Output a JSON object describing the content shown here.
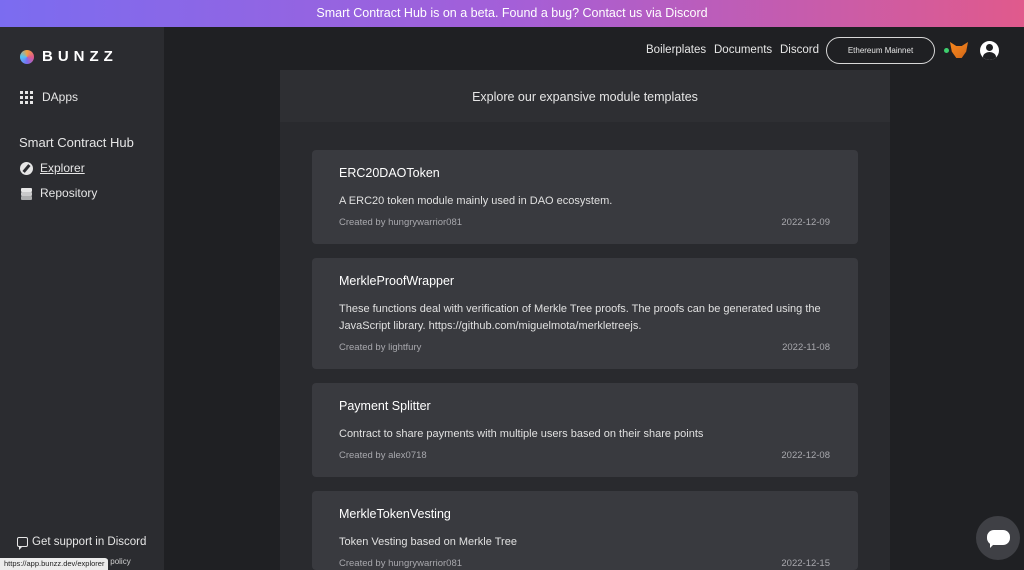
{
  "banner": {
    "text": "Smart Contract Hub is on a beta. Found a bug? Contact us via Discord"
  },
  "sidebar": {
    "logo_text": "BUNZZ",
    "dapps_label": "DApps",
    "hub_title": "Smart Contract Hub",
    "explorer_label": "Explorer",
    "repository_label": "Repository",
    "support_label": "Get support in Discord",
    "terms_label": "Terms of Service  Privacy policy"
  },
  "status_bar": {
    "url": "https://app.bunzz.dev/explorer"
  },
  "topnav": {
    "boilerplates": "Boilerplates",
    "documents": "Documents",
    "discord": "Discord",
    "network": "Ethereum Mainnet"
  },
  "main": {
    "header": "Explore our expansive module templates",
    "cards": [
      {
        "title": "ERC20DAOToken",
        "description": "A ERC20 token module mainly used in DAO ecosystem.",
        "author": "Created by hungrywarrior081",
        "date": "2022-12-09"
      },
      {
        "title": "MerkleProofWrapper",
        "description": "These functions deal with verification of Merkle Tree proofs. The proofs can be generated using the JavaScript library. https://github.com/miguelmota/merkletreejs.",
        "author": "Created by lightfury",
        "date": "2022-11-08"
      },
      {
        "title": "Payment Splitter",
        "description": "Contract to share payments with multiple users based on their share points",
        "author": "Created by alex0718",
        "date": "2022-12-08"
      },
      {
        "title": "MerkleTokenVesting",
        "description": "Token Vesting based on Merkle Tree",
        "author": "Created by hungrywarrior081",
        "date": "2022-12-15"
      }
    ]
  },
  "icons": {
    "logo": "bunzz-logo-icon",
    "dapps": "grid-icon",
    "explorer": "compass-icon",
    "repository": "layers-icon",
    "support": "chat-icon",
    "wallet": "metamask-fox-icon",
    "account": "user-icon",
    "chat_widget": "chat-bubble-icon"
  },
  "colors": {
    "banner_start": "#7b6cf0",
    "banner_end": "#e05a8c",
    "background": "#1f2023",
    "sidebar": "#2b2c30",
    "card": "#393a3f",
    "connected": "#3ecf6e"
  }
}
